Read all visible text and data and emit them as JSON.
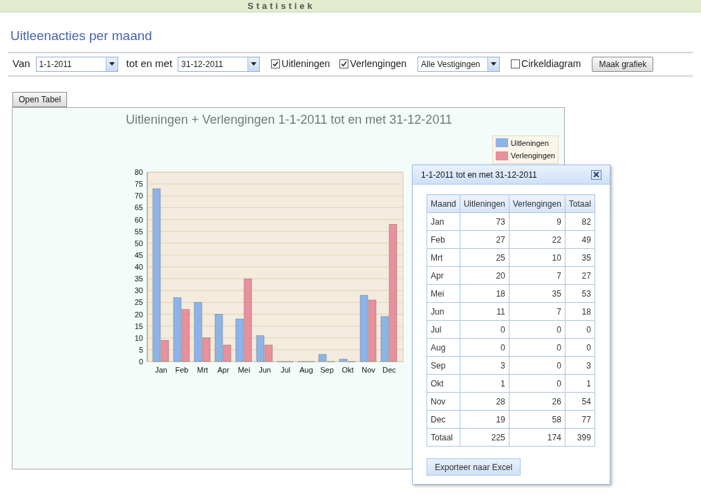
{
  "header": {
    "title": "Statistiek"
  },
  "page_title": "Uitleenacties per maand",
  "filters": {
    "from_label": "Van",
    "from_value": "1-1-2011",
    "to_label": "tot en met",
    "to_value": "31-12-2011",
    "checkboxes": [
      {
        "label": "Uitleningen",
        "checked": true
      },
      {
        "label": "Verlengingen",
        "checked": true
      }
    ],
    "branch": "Alle Vestigingen",
    "pie": {
      "label": "Cirkeldiagram",
      "checked": false
    },
    "button": "Maak grafiek"
  },
  "open_table_button": "Open Tabel",
  "chart": {
    "chart_data": {
      "type": "bar",
      "title": "Uitleningen + Verlengingen 1-1-2011 tot en met 31-12-2011",
      "categories": [
        "Jan",
        "Feb",
        "Mrt",
        "Apr",
        "Mei",
        "Jun",
        "Jul",
        "Aug",
        "Sep",
        "Okt",
        "Nov",
        "Dec"
      ],
      "series": [
        {
          "name": "Uitleningen",
          "color": "#8db4e8",
          "values": [
            73,
            27,
            25,
            20,
            18,
            11,
            0,
            0,
            3,
            1,
            28,
            19
          ]
        },
        {
          "name": "Verlengingen",
          "color": "#e8909c",
          "values": [
            9,
            22,
            10,
            7,
            35,
            7,
            0,
            0,
            0,
            0,
            26,
            58
          ]
        }
      ],
      "ylim": [
        0,
        80
      ],
      "grid": true,
      "legend": true,
      "yticks": [
        0,
        5,
        10,
        15,
        20,
        25,
        30,
        35,
        40,
        45,
        50,
        55,
        60,
        65,
        70,
        75,
        80
      ]
    }
  },
  "dialog": {
    "title": "1-1-2011 tot en met 31-12-2011",
    "columns": [
      "Maand",
      "Uitleningen",
      "Verlengingen",
      "Totaal"
    ],
    "rows": [
      [
        "Jan",
        "73",
        "9",
        "82"
      ],
      [
        "Feb",
        "27",
        "22",
        "49"
      ],
      [
        "Mrt",
        "25",
        "10",
        "35"
      ],
      [
        "Apr",
        "20",
        "7",
        "27"
      ],
      [
        "Mei",
        "18",
        "35",
        "53"
      ],
      [
        "Jun",
        "11",
        "7",
        "18"
      ],
      [
        "Jul",
        "0",
        "0",
        "0"
      ],
      [
        "Aug",
        "0",
        "0",
        "0"
      ],
      [
        "Sep",
        "3",
        "0",
        "3"
      ],
      [
        "Okt",
        "1",
        "0",
        "1"
      ],
      [
        "Nov",
        "28",
        "26",
        "54"
      ],
      [
        "Dec",
        "19",
        "58",
        "77"
      ],
      [
        "Totaal",
        "225",
        "174",
        "399"
      ]
    ],
    "export_button": "Exporteer naar Excel"
  }
}
